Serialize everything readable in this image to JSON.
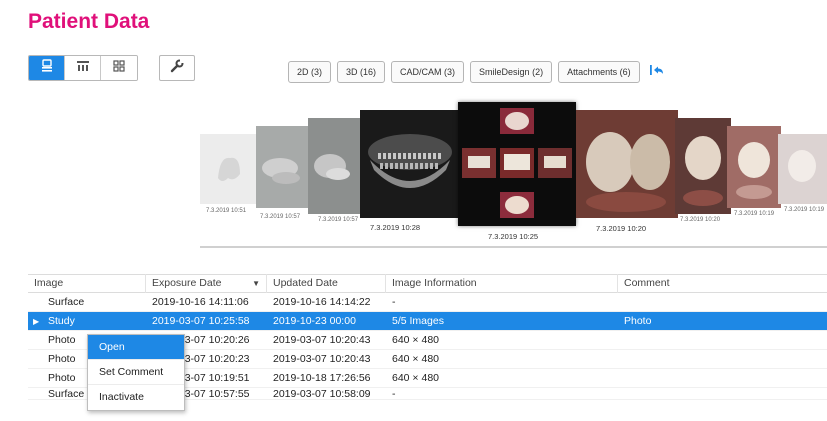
{
  "page": {
    "title": "Patient Data"
  },
  "toolbar": {
    "view_modes": [
      "viewer-icon",
      "timeline-icon",
      "grid-icon"
    ],
    "active_mode": 0,
    "tool_icon": "wrench-icon"
  },
  "filters": [
    "2D (3)",
    "3D (16)",
    "CAD/CAM (3)",
    "SmileDesign (2)",
    "Attachments (6)"
  ],
  "undo_icon": "undo-arrow-icon",
  "gallery": {
    "captions": [
      "7.3.2019 10:51",
      "7.3.2019 10:57",
      "7.3.2019 10:57",
      "7.3.2019 10:28",
      "7.3.2019 10:25",
      "7.3.2019 10:20",
      "7.3.2019 10:20",
      "7.3.2019 10:19",
      "7.3.2019 10:19"
    ],
    "selected_caption": "7.3.2019 10:25"
  },
  "grid": {
    "columns": [
      "Image",
      "Exposure Date",
      "Updated Date",
      "Image Information",
      "Comment"
    ],
    "sort_indicator": "▼",
    "selected_marker": "▶",
    "rows": [
      {
        "image": "Surface",
        "exposure": "2019-10-16 14:11:06",
        "updated": "2019-10-16 14:14:22",
        "info": "-",
        "comment": ""
      },
      {
        "image": "Study",
        "exposure": "2019-03-07 10:25:58",
        "updated": "2019-10-23 00:00",
        "info": "5/5 Images",
        "comment": "Photo"
      },
      {
        "image": "Photo",
        "exposure": "2019-03-07 10:20:26",
        "updated": "2019-03-07 10:20:43",
        "info": "640 × 480",
        "comment": ""
      },
      {
        "image": "Photo",
        "exposure": "2019-03-07 10:20:23",
        "updated": "2019-03-07 10:20:43",
        "info": "640 × 480",
        "comment": ""
      },
      {
        "image": "Photo",
        "exposure": "2019-03-07 10:19:51",
        "updated": "2019-10-18 17:26:56",
        "info": "640 × 480",
        "comment": ""
      },
      {
        "image": "Surface",
        "exposure": "2019-03-07 10:57:55",
        "updated": "2019-03-07 10:58:09",
        "info": "-",
        "comment": ""
      }
    ]
  },
  "context_menu": {
    "items": [
      "Open",
      "Set Comment",
      "Inactivate"
    ],
    "highlighted": 0
  },
  "colors": {
    "accent": "#1e88e5",
    "title": "#e0107a"
  }
}
